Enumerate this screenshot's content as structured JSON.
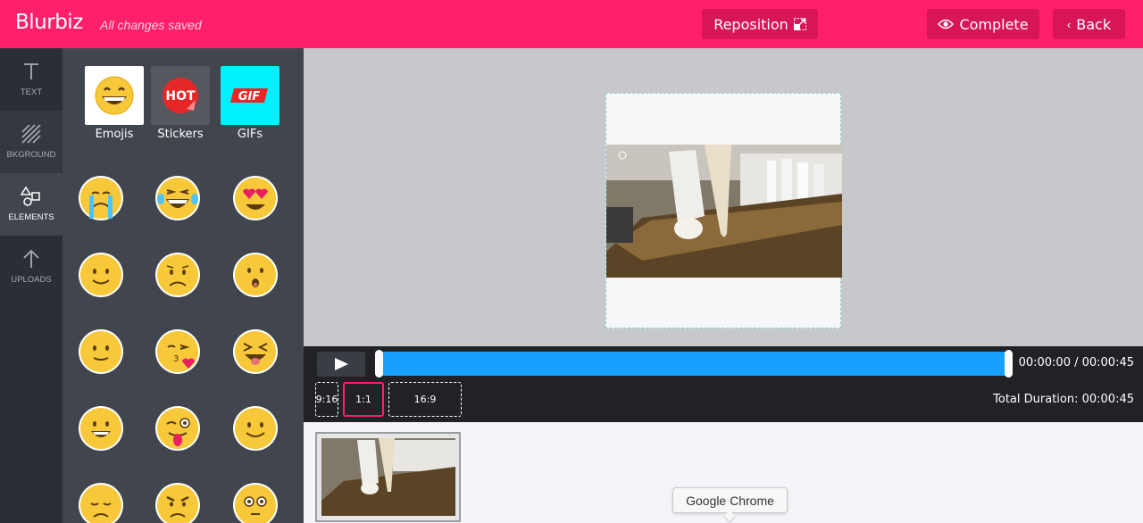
{
  "app": {
    "name": "Blurbiz",
    "status": "All changes saved"
  },
  "toolbar": {
    "reposition_label": "Reposition",
    "complete_label": "Complete",
    "back_label": "Back"
  },
  "rail": [
    {
      "label": "TEXT",
      "icon": "text-icon"
    },
    {
      "label": "BKGROUND",
      "icon": "background-icon"
    },
    {
      "label": "ELEMENTS",
      "icon": "shapes-icon",
      "active": true
    },
    {
      "label": "UPLOADS",
      "icon": "upload-arrow-icon"
    }
  ],
  "panel": {
    "tabs": [
      {
        "label": "Emojis",
        "icon": "grinning-emoji-icon"
      },
      {
        "label": "Stickers",
        "icon": "hot-sticker-icon"
      },
      {
        "label": "GIFs",
        "icon": "gif-icon"
      }
    ],
    "emoji_grid": [
      "crying-emoji",
      "laughing-tears-emoji",
      "heart-eyes-emoji",
      "smiling-emoji",
      "sad-emoji",
      "surprised-emoji",
      "slight-smile-emoji",
      "kissing-heart-emoji",
      "squinting-tongue-emoji",
      "grin-emoji",
      "winking-tongue-emoji",
      "smiley-emoji",
      "disappointed-emoji",
      "angry-emoji",
      "flushed-emoji"
    ]
  },
  "player": {
    "time": "00:00:00 / 00:00:45",
    "total_duration": "Total Duration: 00:00:45",
    "ratios": [
      "9:16",
      "1:1",
      "16:9"
    ],
    "selected_ratio": "1:1",
    "progress": 0
  },
  "tooltip": "Google Chrome",
  "colors": {
    "brand": "#ff1f6b",
    "track": "#16a0ff",
    "emoji": "#f7c93a"
  }
}
